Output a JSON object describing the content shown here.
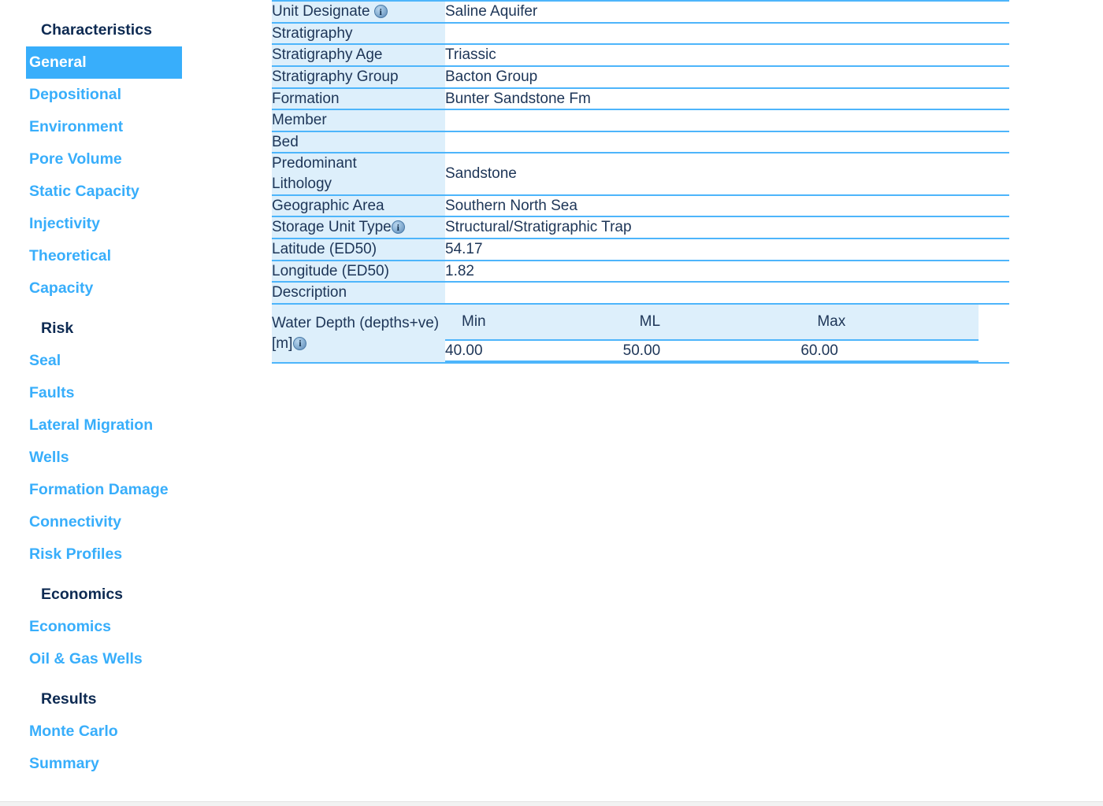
{
  "sidebar": {
    "sections": [
      {
        "heading": "Characteristics",
        "items": [
          {
            "label": "General",
            "active": true
          },
          {
            "label": "Depositional",
            "active": false
          },
          {
            "label": "Environment",
            "active": false
          },
          {
            "label": "Pore Volume",
            "active": false
          },
          {
            "label": "Static Capacity",
            "active": false
          },
          {
            "label": "Injectivity",
            "active": false
          },
          {
            "label": "Theoretical",
            "active": false
          },
          {
            "label": "Capacity",
            "active": false
          }
        ]
      },
      {
        "heading": "Risk",
        "items": [
          {
            "label": "Seal",
            "active": false
          },
          {
            "label": "Faults",
            "active": false
          },
          {
            "label": "Lateral Migration",
            "active": false
          },
          {
            "label": "Wells",
            "active": false
          },
          {
            "label": "Formation Damage",
            "active": false
          },
          {
            "label": "Connectivity",
            "active": false
          },
          {
            "label": "Risk Profiles",
            "active": false
          }
        ]
      },
      {
        "heading": "Economics",
        "items": [
          {
            "label": "Economics",
            "active": false
          },
          {
            "label": "Oil & Gas Wells",
            "active": false
          }
        ]
      },
      {
        "heading": "Results",
        "items": [
          {
            "label": "Monte Carlo",
            "active": false
          },
          {
            "label": "Summary",
            "active": false
          }
        ]
      }
    ]
  },
  "details": {
    "rows": [
      {
        "label": "Unit Designate",
        "info": true,
        "value": "Saline Aquifer"
      },
      {
        "label": "Stratigraphy",
        "info": false,
        "value": ""
      },
      {
        "label": "Stratigraphy Age",
        "info": false,
        "value": "Triassic"
      },
      {
        "label": "Stratigraphy Group",
        "info": false,
        "value": "Bacton Group"
      },
      {
        "label": "Formation",
        "info": false,
        "value": "Bunter Sandstone Fm"
      },
      {
        "label": "Member",
        "info": false,
        "value": ""
      },
      {
        "label": "Bed",
        "info": false,
        "value": ""
      },
      {
        "label": "Predominant Lithology",
        "info": false,
        "value": "Sandstone"
      },
      {
        "label": "Geographic Area",
        "info": false,
        "value": "Southern North Sea"
      },
      {
        "label": "Storage Unit Type",
        "info": true,
        "value": "Structural/Stratigraphic Trap"
      },
      {
        "label": "Latitude (ED50)",
        "info": false,
        "value": "54.17"
      },
      {
        "label": "Longitude (ED50)",
        "info": false,
        "value": "1.82"
      },
      {
        "label": "Description",
        "info": false,
        "value": ""
      }
    ],
    "water_depth": {
      "label": "Water Depth (depths+ve)[m]",
      "info": true,
      "columns": [
        "Min",
        "ML",
        "Max"
      ],
      "values": [
        "40.00",
        "50.00",
        "60.00"
      ]
    }
  },
  "colors": {
    "accent": "#38aefb",
    "label_cell_bg": "#ddeffb",
    "row_divider": "#4db5fb",
    "text_dark": "#1d3557",
    "heading_dark": "#0d2a52"
  }
}
